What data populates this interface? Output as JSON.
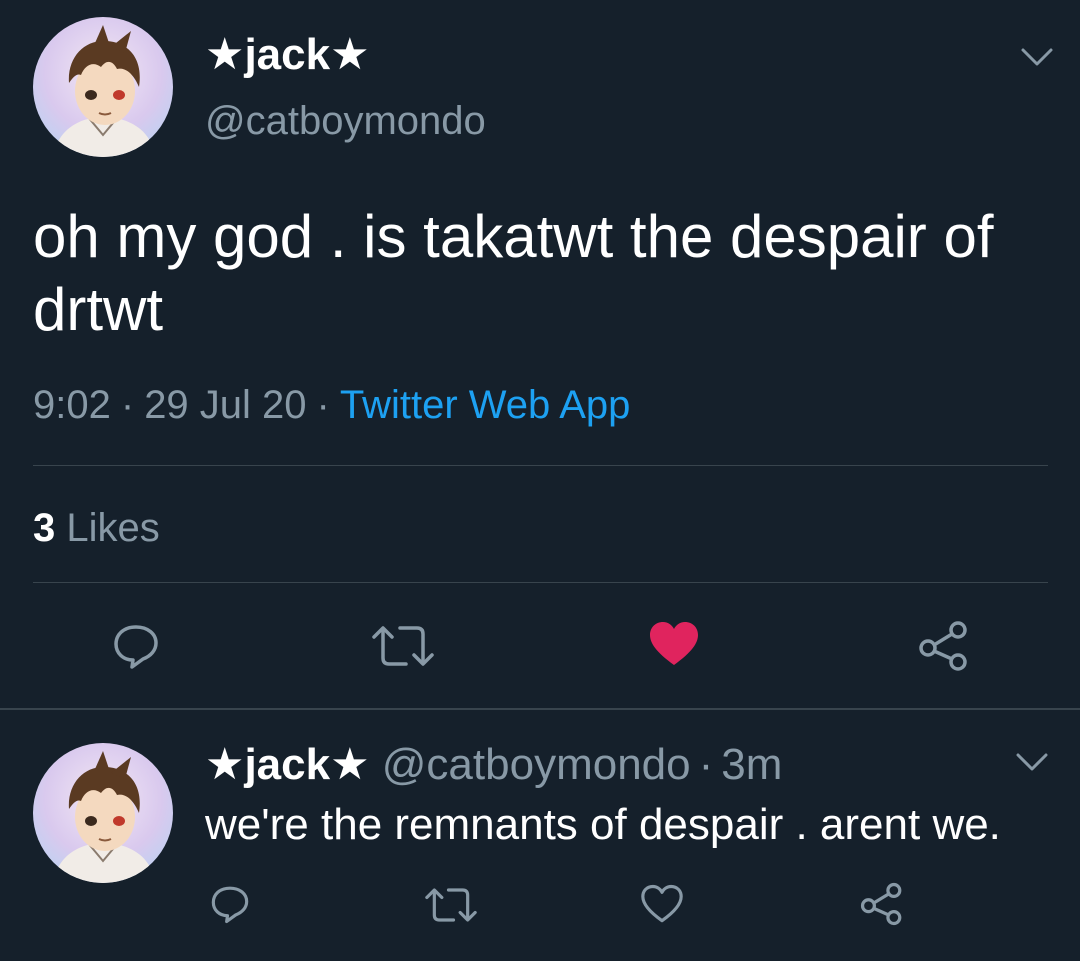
{
  "tweet": {
    "display_name": "★jack★",
    "handle": "@catboymondo",
    "text": "oh my god . is takatwt the despair of drtwt",
    "time": "9:02",
    "date": "29 Jul 20",
    "separator": "·",
    "source": "Twitter Web App",
    "likes_count": "3",
    "likes_label": "Likes",
    "liked": true
  },
  "reply": {
    "display_name": "★jack★",
    "handle": "@catboymondo",
    "separator": "·",
    "time": "3m",
    "text": "we're the remnants of despair . arent we.",
    "liked": false
  },
  "icons": {
    "reply": "speech-bubble",
    "retweet": "retweet-arrows",
    "like": "heart",
    "share": "share-nodes",
    "more": "chevron-down"
  },
  "colors": {
    "background": "#15202b",
    "secondary_text": "#8899a6",
    "link": "#1da1f2",
    "like_active": "#e0245e",
    "divider": "#38444d"
  }
}
